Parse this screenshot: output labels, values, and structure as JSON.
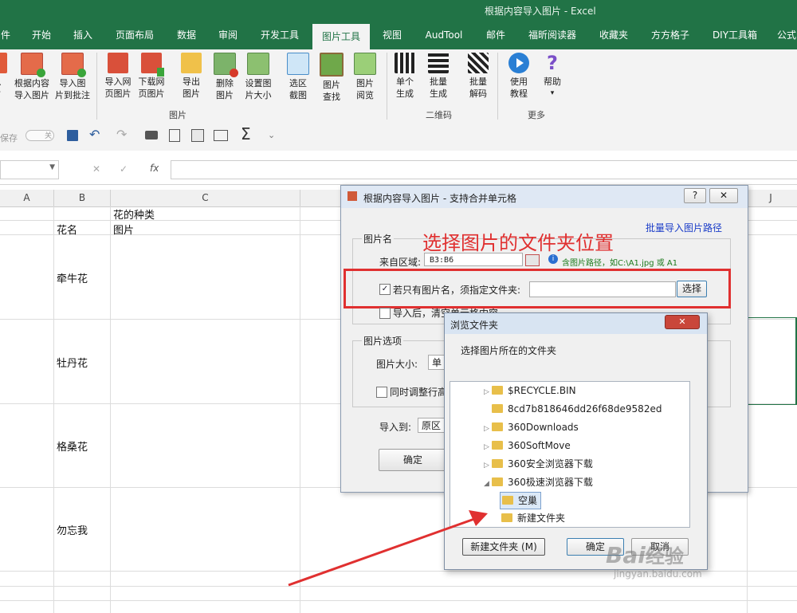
{
  "window": {
    "title": "根据内容导入图片 - Excel"
  },
  "tabs": [
    "件",
    "开始",
    "插入",
    "页面布局",
    "数据",
    "审阅",
    "开发工具",
    "图片工具",
    "视图",
    "AudTool",
    "邮件",
    "福昕阅读器",
    "收藏夹",
    "方方格子",
    "DIY工具箱",
    "公式"
  ],
  "active_tab": "图片工具",
  "ribbon": {
    "buttons": [
      {
        "label1": "入",
        "label2": "片"
      },
      {
        "label1": "根据内容",
        "label2": "导入图片"
      },
      {
        "label1": "导入图",
        "label2": "片到批注"
      },
      {
        "label1": "导入网",
        "label2": "页图片"
      },
      {
        "label1": "下载网",
        "label2": "页图片"
      },
      {
        "label1": "导出",
        "label2": "图片"
      },
      {
        "label1": "删除",
        "label2": "图片"
      },
      {
        "label1": "设置图",
        "label2": "片大小"
      },
      {
        "label1": "选区",
        "label2": "截图"
      },
      {
        "label1": "图片",
        "label2": "查找"
      },
      {
        "label1": "图片",
        "label2": "阅览"
      },
      {
        "label1": "单个",
        "label2": "生成"
      },
      {
        "label1": "批量",
        "label2": "生成"
      },
      {
        "label1": "批量",
        "label2": "解码"
      },
      {
        "label1": "使用",
        "label2": "教程"
      },
      {
        "label1": "帮助",
        "label2": "▾"
      }
    ],
    "groups": [
      "图片",
      "二维码",
      "更多"
    ]
  },
  "qat": {
    "autosave": "保存",
    "toggle": "关"
  },
  "formula": {
    "cancel": "✕",
    "confirm": "✓",
    "fx": "fx"
  },
  "columns": [
    "A",
    "B",
    "C",
    "J"
  ],
  "cells": {
    "c2": "花的种类",
    "b3": "花名",
    "c3": "图片",
    "b4": "牵牛花",
    "b5": "牡丹花",
    "b6": "格桑花",
    "b7": "勿忘我"
  },
  "dialog": {
    "title": "根据内容导入图片 - 支持合并单元格",
    "help": "?",
    "close": "✕",
    "batch_link": "批量导入图片路径",
    "annotation": "选择图片的文件夹位置",
    "group_name": "图片名",
    "source_label": "来自区域:",
    "source_value": "B3:B6",
    "hint": "含图片路径，如C:\\A1.jpg 或 A1",
    "only_name_label": "若只有图片名，须指定文件夹:",
    "folder_value": "",
    "choose_button": "选择",
    "clear_label": "导入后，清空单元格内容",
    "group_options": "图片选项",
    "size_label": "图片大小:",
    "size_value": "单",
    "adjust_label": "同时调整行高",
    "import_to_label": "导入到:",
    "import_to_value": "原区",
    "ok_button": "确定"
  },
  "browse": {
    "title": "浏览文件夹",
    "close": "✕",
    "prompt": "选择图片所在的文件夹",
    "items": [
      "$RECYCLE.BIN",
      "8cd7b818646dd26f68de9582ed",
      "360Downloads",
      "360SoftMove",
      "360安全浏览器下载",
      "360极速浏览器下载",
      "空巢",
      "新建文件夹"
    ],
    "selected": "空巢",
    "new_folder_button": "新建文件夹 (M)",
    "ok_button": "确定",
    "cancel_button": "取消"
  },
  "watermark": {
    "text1": "Bai",
    "text2": "经验",
    "url": "jingyan.baidu.com"
  },
  "colors": {
    "excel_green": "#217346",
    "annotation_red": "#e03030",
    "link_blue": "#1a3cc8"
  }
}
